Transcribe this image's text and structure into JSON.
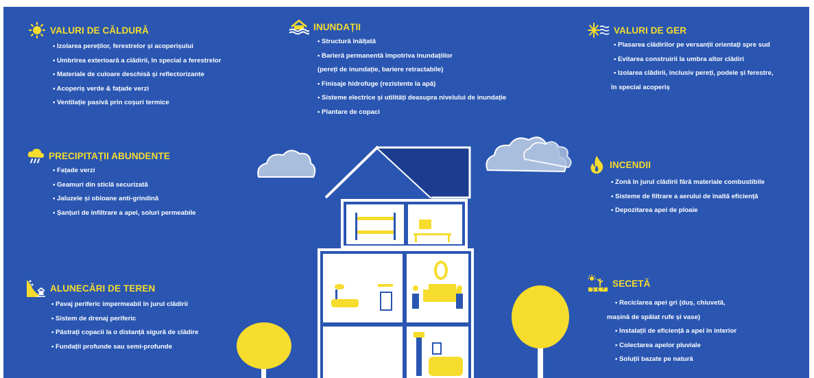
{
  "colors": {
    "background": "#2a56b2",
    "title": "#f6dc2d",
    "text": "#ffffff",
    "cloud": "#a9bddd",
    "house_fill": "#ffffff",
    "house_dark": "#1c3d8f"
  },
  "sections": {
    "heat": {
      "icon": "sun-icon",
      "title": "VALURI DE CĂLDURĂ",
      "items": [
        "• Izolarea pereților, ferestrelor și acoperișului",
        "• Umbrirea exterioară a clădirii, în special a ferestrelor",
        "• Materiale de culoare deschisă și reflectorizante",
        "• Acoperiș verde & fațade verzi",
        "• Ventilație pasivă prin coșuri termice"
      ]
    },
    "flood": {
      "icon": "flooded-house-icon",
      "title": "INUNDAȚII",
      "items": [
        "• Structură înălțată",
        "• Barieră permanentă împotriva inundațiilor",
        "(pereți de inundație, bariere retractabile)",
        "• Finisaje hidrofuge (rezistente la apă)",
        "• Sisteme electrice și utilități deasupra nivelului de inundație",
        "• Plantare de copaci"
      ]
    },
    "cold": {
      "icon": "snowflake-icon",
      "title": "VALURI DE GER",
      "items": [
        "• Plasarea clădirilor pe versanții orientați spre sud",
        "• Evitarea construirii la umbra altor clădiri",
        "• Izolarea clădirii, inclusiv pereți, podele și ferestre,",
        "în special acoperiș"
      ]
    },
    "rain": {
      "icon": "rain-cloud-icon",
      "title": "PRECIPITAȚII ABUNDENTE",
      "items": [
        "• Fațade verzi",
        "• Geamuri din sticlă securizată",
        "• Jaluzele și obloane anti-grindină",
        "• Șanțuri de infiltrare a apei, soluri permeabile"
      ]
    },
    "fire": {
      "icon": "flame-icon",
      "title": "INCENDII",
      "items": [
        "• Zonă în jurul clădirii fără materiale combustibile",
        "• Sisteme de filtrare a aerului de înaltă eficiență",
        "• Depozitarea apei de ploaie"
      ]
    },
    "landslide": {
      "icon": "landslide-icon",
      "title": "ALUNECĂRI DE TEREN",
      "items": [
        "• Pavaj periferic impermeabil în jurul clădirii",
        "• Sistem de drenaj periferic",
        "• Păstrați copacii la o distanță sigură de clădire",
        "• Fundații profunde sau semi-profunde"
      ]
    },
    "drought": {
      "icon": "drought-icon",
      "title": "SECETĂ",
      "items": [
        "• Reciclarea apei gri (duș, chiuvetă,",
        "mașină de spălat rufe și vase)",
        "• Instalații de eficiență a apei în interior",
        "• Colectarea apelor pluviale",
        "• Soluții bazate pe natură"
      ]
    }
  }
}
